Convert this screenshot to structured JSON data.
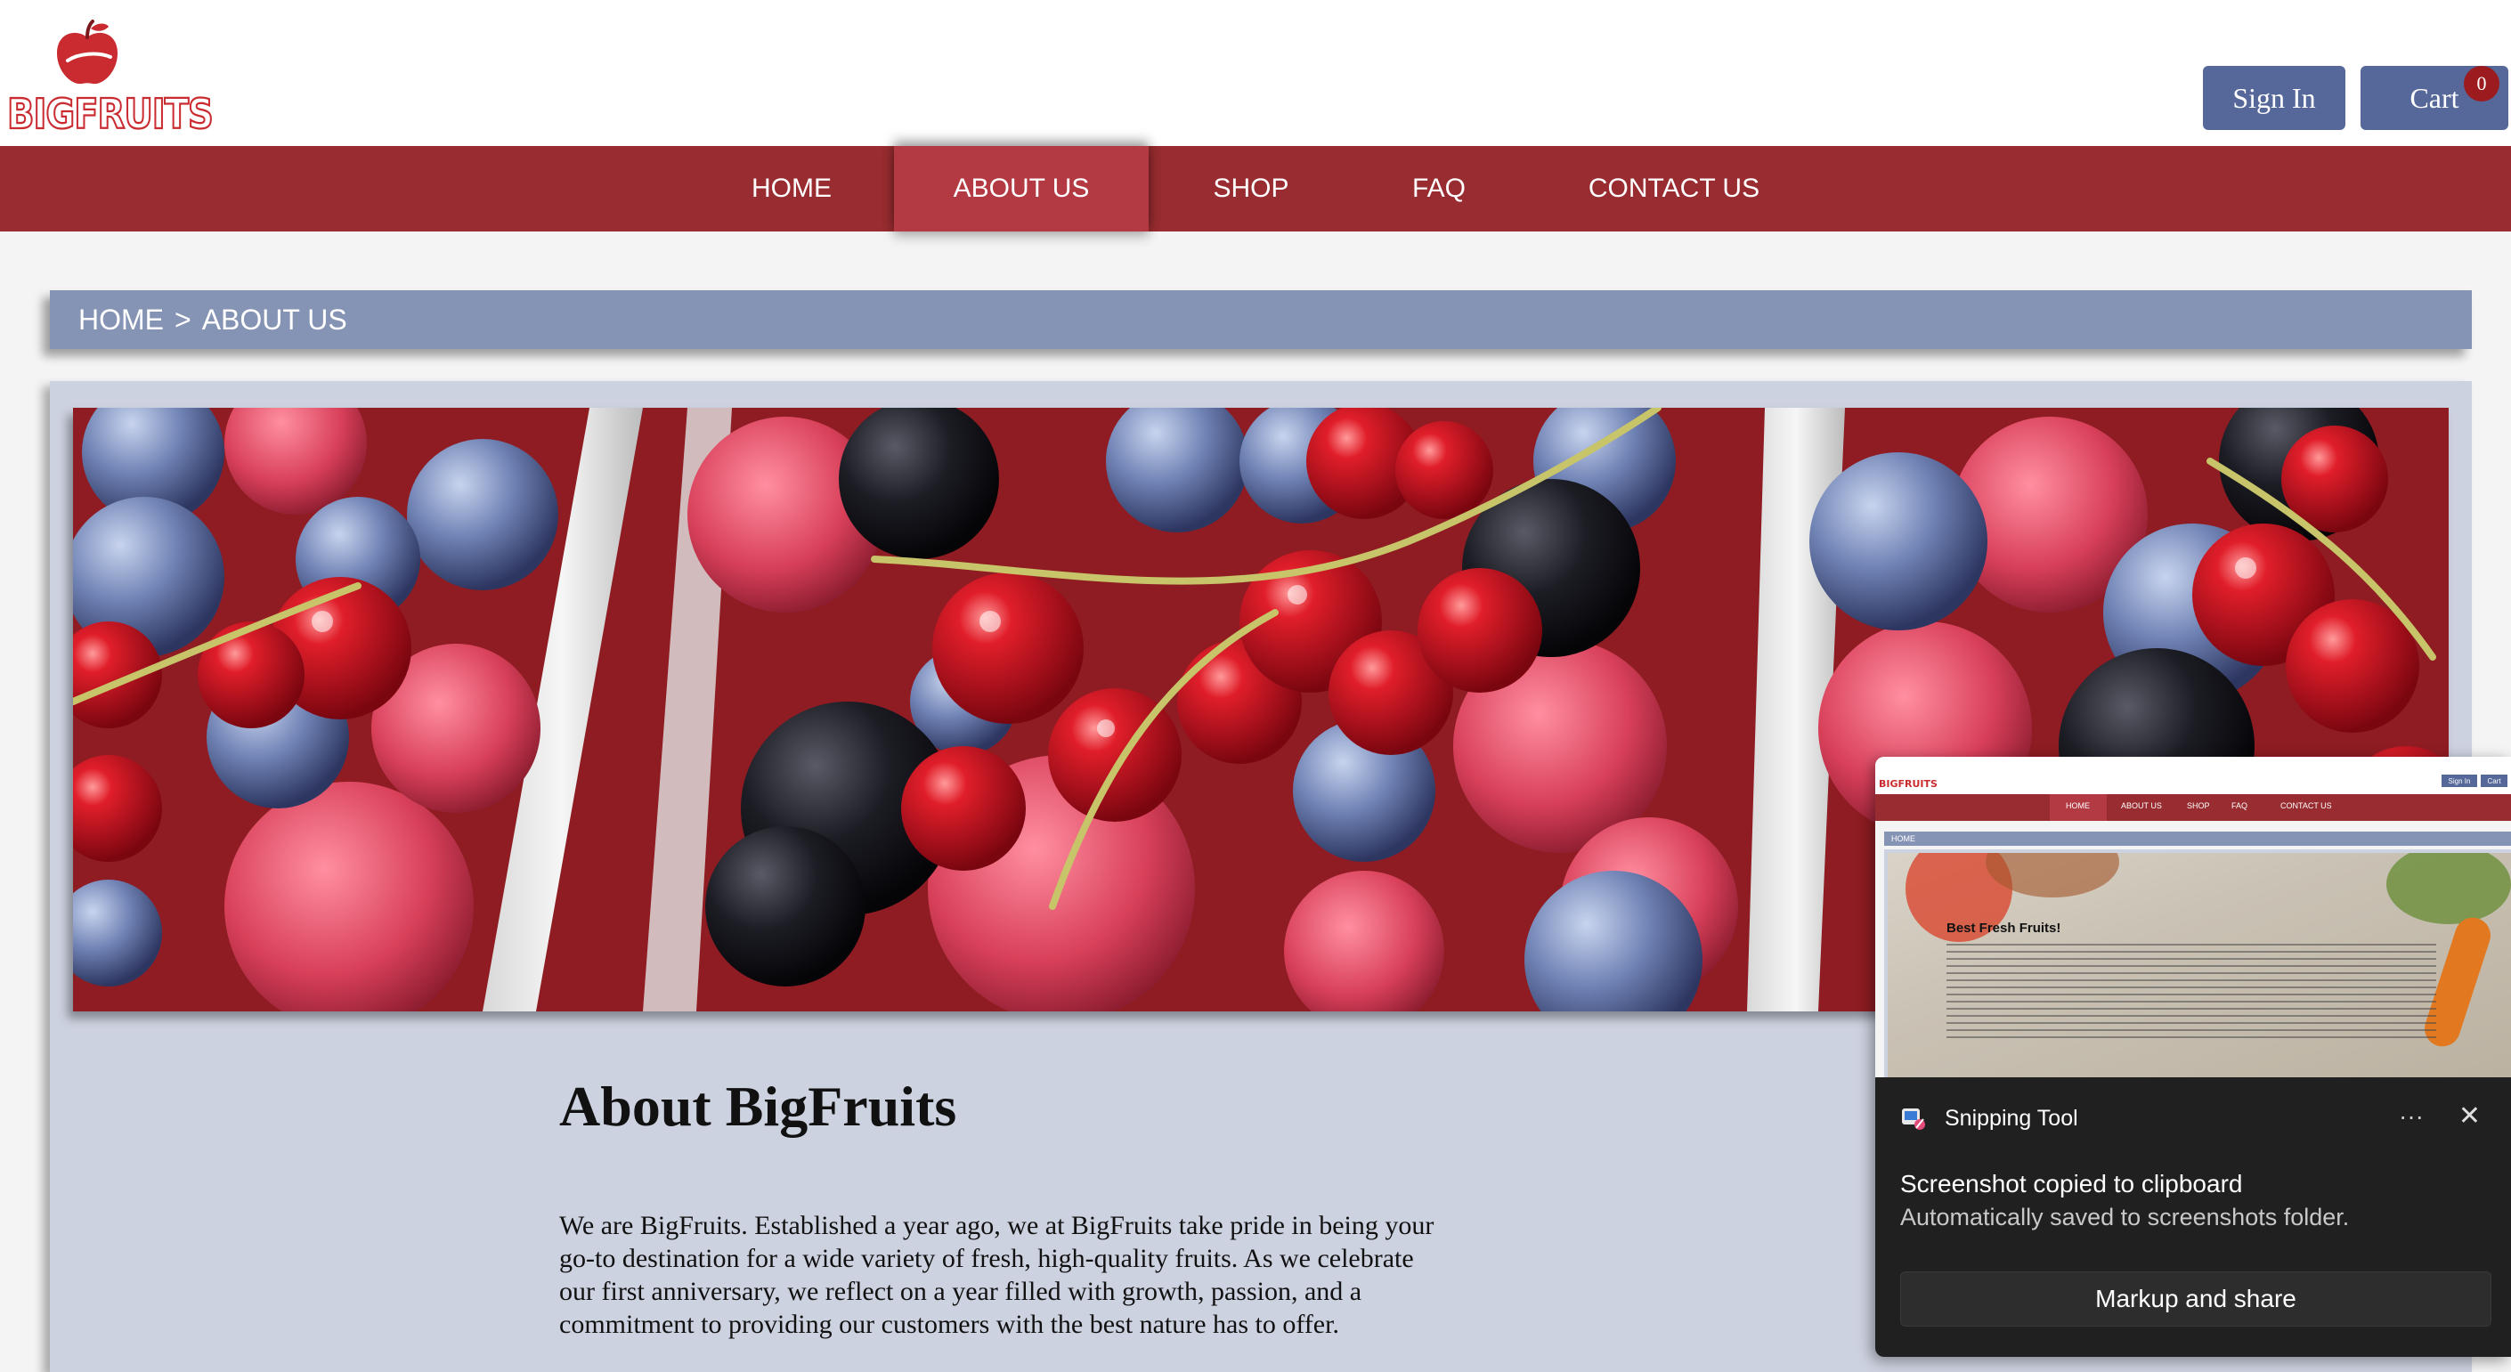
{
  "header": {
    "logo_text": "BIGFRUITS",
    "sign_in_label": "Sign In",
    "cart_label": "Cart",
    "cart_count": "0"
  },
  "nav": {
    "items": [
      "HOME",
      "ABOUT US",
      "SHOP",
      "FAQ",
      "CONTACT US"
    ],
    "active": "ABOUT US"
  },
  "breadcrumb": {
    "home": "HOME",
    "separator": ">",
    "current": "ABOUT US"
  },
  "hero": {
    "icon": "mixed-berries-image"
  },
  "about": {
    "title": "About BigFruits",
    "body": "We are BigFruits. Established a year ago, we at BigFruits take pride in being your go-to destination for a wide variety of fresh, high-quality fruits. As we celebrate our first anniversary, we reflect on a year filled with growth, passion, and a commitment to providing our customers with the best nature has to offer."
  },
  "notification": {
    "app_name": "Snipping Tool",
    "title": "Screenshot copied to clipboard",
    "subtitle": "Automatically saved to screenshots folder.",
    "action_label": "Markup and share",
    "preview": {
      "nav_items": [
        "HOME",
        "ABOUT US",
        "SHOP",
        "FAQ",
        "CONTACT US"
      ],
      "sign_in": "Sign In",
      "cart": "Cart",
      "breadcrumb": "HOME",
      "heading": "Best Fresh Fruits!"
    }
  },
  "colors": {
    "brand_red": "#982c30",
    "active_nav": "#b33a43",
    "button_blue": "#56689a",
    "breadcrumb_bg": "#8594b4",
    "panel_bg": "#cdd2e0"
  }
}
